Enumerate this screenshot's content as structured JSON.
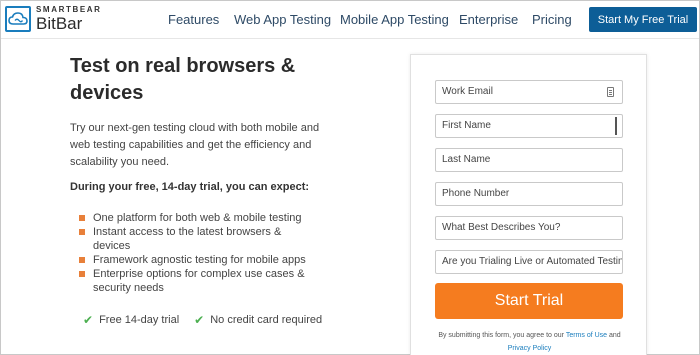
{
  "brand": {
    "small": "SMARTBEAR",
    "name": "BitBar",
    "accent": "#1a7dbd"
  },
  "nav": {
    "items": [
      "Features",
      "Web App Testing",
      "Mobile App Testing",
      "Enterprise",
      "Pricing"
    ],
    "cta": "Start My Free Trial"
  },
  "hero": {
    "title": "Test on real browsers & devices",
    "description": "Try our next-gen testing cloud with both mobile and web testing capabilities and get the efficiency and scalability you need.",
    "trial_heading": "During your free, 14-day trial, you can expect:",
    "bullets": [
      "One platform for both web & mobile testing",
      "Instant access to the latest browsers & devices",
      "Framework agnostic testing for mobile apps",
      "Enterprise options for complex use cases & security needs"
    ],
    "checks": [
      "Free 14-day trial",
      "No credit card required"
    ]
  },
  "form": {
    "fields": [
      "Work Email",
      "First Name",
      "Last Name",
      "Phone Number",
      "What Best Describes You?",
      "Are you Trialing Live or Automated Testing?"
    ],
    "submit": "Start Trial",
    "legal_prefix": "By submitting this form, you agree to our",
    "terms": "Terms of Use",
    "legal_and": "and",
    "privacy": "Privacy Policy",
    "button_color": "#f57c1f"
  }
}
